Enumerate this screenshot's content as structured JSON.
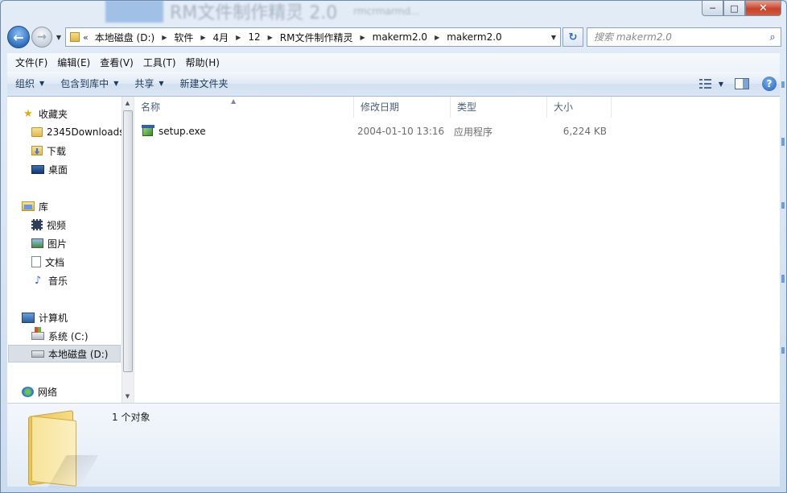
{
  "window": {
    "ghost_title": "RM文件制作精灵 2.0",
    "ghost_subtitle": "rmcrmarmd..."
  },
  "caption": {
    "minimize": "─",
    "maximize": "□",
    "close": "✕"
  },
  "nav": {
    "back_glyph": "←",
    "forward_glyph": "→",
    "history_glyph": "▼"
  },
  "address": {
    "lead": "«",
    "crumbs": [
      "本地磁盘 (D:)",
      "软件",
      "4月",
      "12",
      "RM文件制作精灵",
      "makerm2.0",
      "makerm2.0"
    ],
    "separator": "▶",
    "dropdown": "▼",
    "refresh_glyph": "↻"
  },
  "search": {
    "placeholder": "搜索 makerm2.0",
    "icon": "search-icon"
  },
  "menu": [
    "文件(F)",
    "编辑(E)",
    "查看(V)",
    "工具(T)",
    "帮助(H)"
  ],
  "commands": {
    "organize": "组织",
    "include_library": "包含到库中",
    "share": "共享",
    "new_folder": "新建文件夹",
    "arrow": "▼",
    "help": "?"
  },
  "sidebar": {
    "favorites": "收藏夹",
    "favorites_items": [
      "2345Downloads",
      "下载",
      "桌面"
    ],
    "libraries": "库",
    "libraries_items": [
      "视频",
      "图片",
      "文档",
      "音乐"
    ],
    "computer": "计算机",
    "computer_items": [
      "系统 (C:)",
      "本地磁盘 (D:)"
    ],
    "network": "网络",
    "selected": "本地磁盘 (D:)"
  },
  "columns": [
    "名称",
    "修改日期",
    "类型",
    "大小"
  ],
  "sort_glyph": "▲",
  "files": [
    {
      "name": "setup.exe",
      "modified": "2004-01-10 13:16",
      "type": "应用程序",
      "size": "6,224 KB",
      "icon": "exe-icon"
    }
  ],
  "status": {
    "count_text": "1 个对象"
  },
  "colors": {
    "accent": "#2d6fbf",
    "selection": "#d9dfe7",
    "close_red": "#c7432c"
  }
}
